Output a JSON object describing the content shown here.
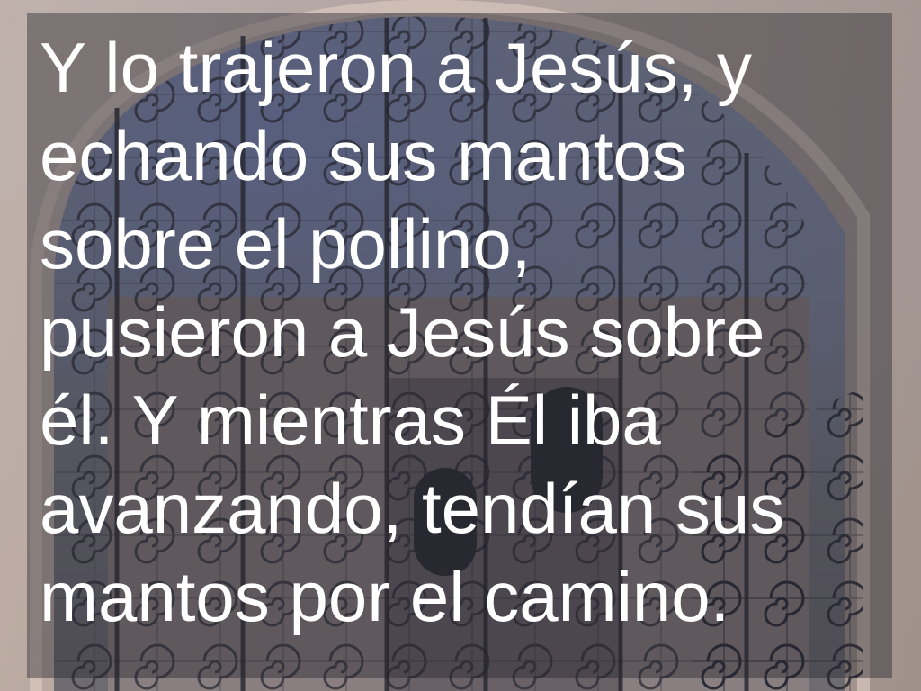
{
  "slide": {
    "lines": [
      "Y lo trajeron a Jesús, y",
      "echando sus mantos",
      "sobre el pollino,",
      "pusieron a Jesús sobre",
      "él. Y mientras Él iba",
      "avanzando, tendían sus",
      "mantos por el camino."
    ],
    "text_color": "#ffffff",
    "overlay_color": "rgba(35, 35, 45, 0.42)",
    "background": "photo of an ornate wrought-iron gate in a stone archway"
  }
}
